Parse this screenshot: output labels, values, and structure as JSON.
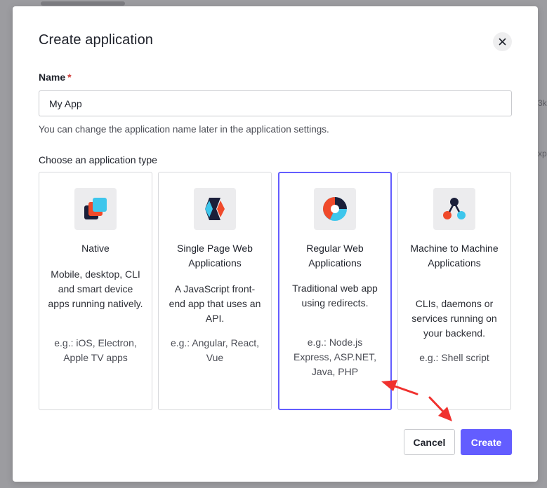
{
  "modal": {
    "title": "Create application",
    "close_icon": "close-icon"
  },
  "name_field": {
    "label": "Name",
    "required_marker": "*",
    "value": "My App",
    "help_text": "You can change the application name later in the application settings."
  },
  "type_section": {
    "label": "Choose an application type",
    "selected": "regular-web",
    "cards": [
      {
        "id": "native",
        "icon": "native-app-icon",
        "title": "Native",
        "description": "Mobile, desktop, CLI and smart device apps running natively.",
        "example": "e.g.: iOS, Electron, Apple TV apps"
      },
      {
        "id": "spa",
        "icon": "spa-icon",
        "title": "Single Page Web Applications",
        "description": "A JavaScript front-end app that uses an API.",
        "example": "e.g.: Angular, React, Vue"
      },
      {
        "id": "regular-web",
        "icon": "regular-web-app-icon",
        "title": "Regular Web Applications",
        "description": "Traditional web app using redirects.",
        "example": "e.g.: Node.js Express, ASP.NET, Java, PHP"
      },
      {
        "id": "m2m",
        "icon": "machine-to-machine-icon",
        "title": "Machine to Machine Applications",
        "description": "CLIs, daemons or services running on your backend.",
        "example": "e.g.: Shell script"
      }
    ]
  },
  "actions": {
    "cancel_label": "Cancel",
    "create_label": "Create"
  },
  "colors": {
    "accent": "#635dff",
    "annotation_arrow": "#f0312e"
  }
}
